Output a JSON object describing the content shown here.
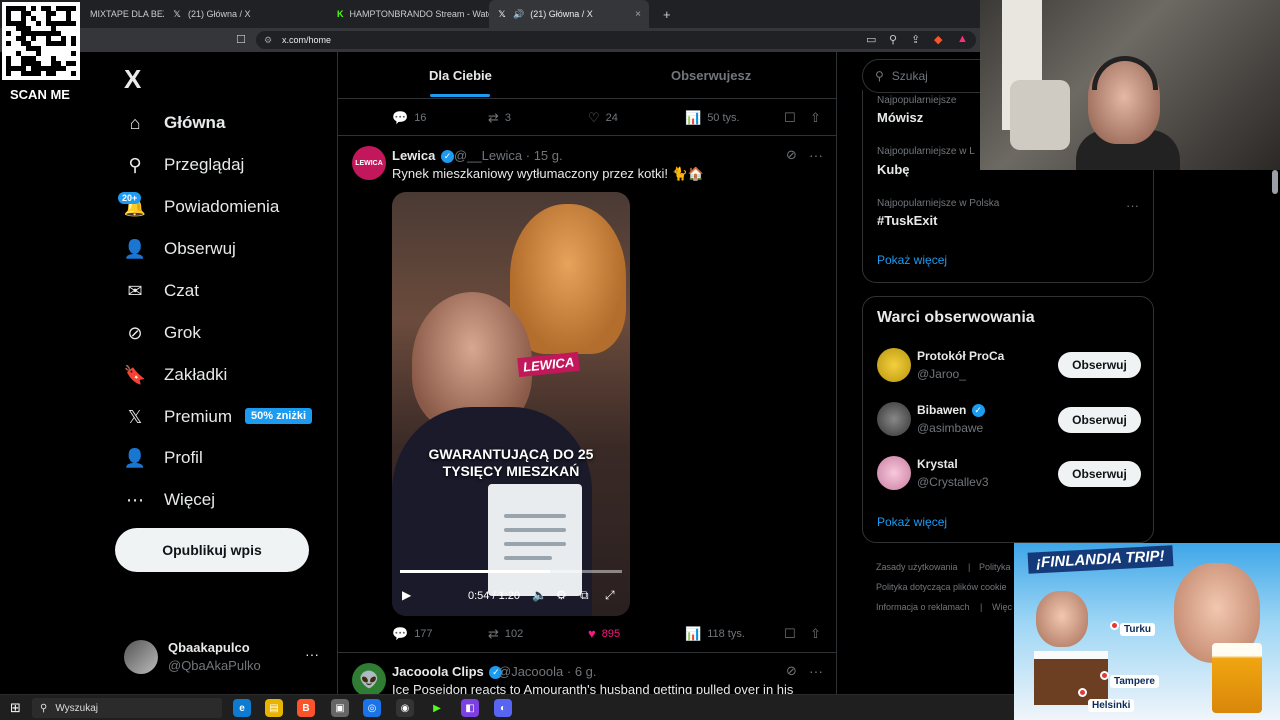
{
  "browser": {
    "tabs": [
      {
        "label": "MIXTAPE DLA BEZRO",
        "icon": "music",
        "active": false
      },
      {
        "label": "(21) Główna / X",
        "icon": "x",
        "active": false
      },
      {
        "label": "HAMPTONBRANDO Stream - Watch",
        "icon": "kick",
        "active": false
      },
      {
        "label": "(21) Główna / X",
        "icon": "x",
        "active": true
      }
    ],
    "new_tab": "+",
    "close": "×",
    "url": "x.com/home"
  },
  "overlay": {
    "scan_me": "SCAN ME",
    "promo_title": "¡FINLANDIA TRIP!",
    "cities": [
      "Turku",
      "Tampere",
      "Helsinki"
    ]
  },
  "nav": {
    "logo": "X",
    "items": [
      {
        "label": "Główna",
        "icon": "⌂",
        "name": "home"
      },
      {
        "label": "Przeglądaj",
        "icon": "⚲",
        "name": "explore"
      },
      {
        "label": "Powiadomienia",
        "icon": "🔔",
        "name": "notifications"
      },
      {
        "label": "Obserwuj",
        "icon": "👤",
        "name": "follow"
      },
      {
        "label": "Czat",
        "icon": "✉",
        "name": "chat"
      },
      {
        "label": "Grok",
        "icon": "⊘",
        "name": "grok"
      },
      {
        "label": "Zakładki",
        "icon": "🔖",
        "name": "bookmarks"
      },
      {
        "label": "Premium",
        "icon": "X",
        "name": "premium"
      },
      {
        "label": "Profil",
        "icon": "👤",
        "name": "profile"
      },
      {
        "label": "Więcej",
        "icon": "⋯",
        "name": "more"
      }
    ],
    "notif_badge": "20+",
    "premium_badge": "50% zniżki",
    "post_button": "Opublikuj wpis",
    "user_name": "Qbaakapulco",
    "user_handle": "@QbaAkaPulko",
    "user_more": "···"
  },
  "timeline": {
    "tabs": [
      "Dla Ciebie",
      "Obserwujesz"
    ],
    "prev_actions": {
      "replies": "16",
      "reposts": "3",
      "likes": "24",
      "views": "50 tys."
    },
    "tweet1": {
      "avatar_text": "LEWICA",
      "name": "Lewica",
      "handle": "@__Lewica",
      "time": "15 g.",
      "text": "Rynek mieszkaniowy wytłumaczony przez kotki! 🐈🏠",
      "video_label": "LEWICA",
      "video_caption": "GWARANTUJĄCĄ DO 25 TYSIĘCY MIESZKAŃ",
      "video_time": "0:54 / 1:20",
      "video_progress": 0.675,
      "replies": "177",
      "reposts": "102",
      "likes": "895",
      "views": "118 tys."
    },
    "tweet2": {
      "name": "Jacooola Clips",
      "handle": "@Jacooola",
      "time": "6 g.",
      "text": "Ice Poseidon reacts to Amouranth's husband getting pulled over in his"
    }
  },
  "right": {
    "search_placeholder": "Szukaj",
    "trends": [
      {
        "context": "Najpopularniejsze",
        "name": "Mówisz"
      },
      {
        "context": "Najpopularniejsze w L",
        "name": "Kubę"
      },
      {
        "context": "Najpopularniejsze w Polska",
        "name": "#TuskExit"
      }
    ],
    "show_more": "Pokaż więcej",
    "who_title": "Warci obserwowania",
    "suggestions": [
      {
        "name": "Protokół ProCa",
        "handle": "@Jaroo_",
        "verified": false
      },
      {
        "name": "Bibawen",
        "handle": "@asimbawe",
        "verified": true
      },
      {
        "name": "Krystal",
        "handle": "@Crystallev3",
        "verified": false
      }
    ],
    "follow_label": "Obserwuj",
    "footer": [
      "Zasady użytkowania",
      "|",
      "Polityka",
      "Polityka dotycząca plików cookie",
      "Informacja o reklamach",
      "|",
      "Więc"
    ]
  },
  "taskbar": {
    "search": "Wyszukaj"
  },
  "colors": {
    "accent": "#1d9bf0",
    "like": "#f91880",
    "bg": "#000000",
    "border": "#2f3336"
  }
}
